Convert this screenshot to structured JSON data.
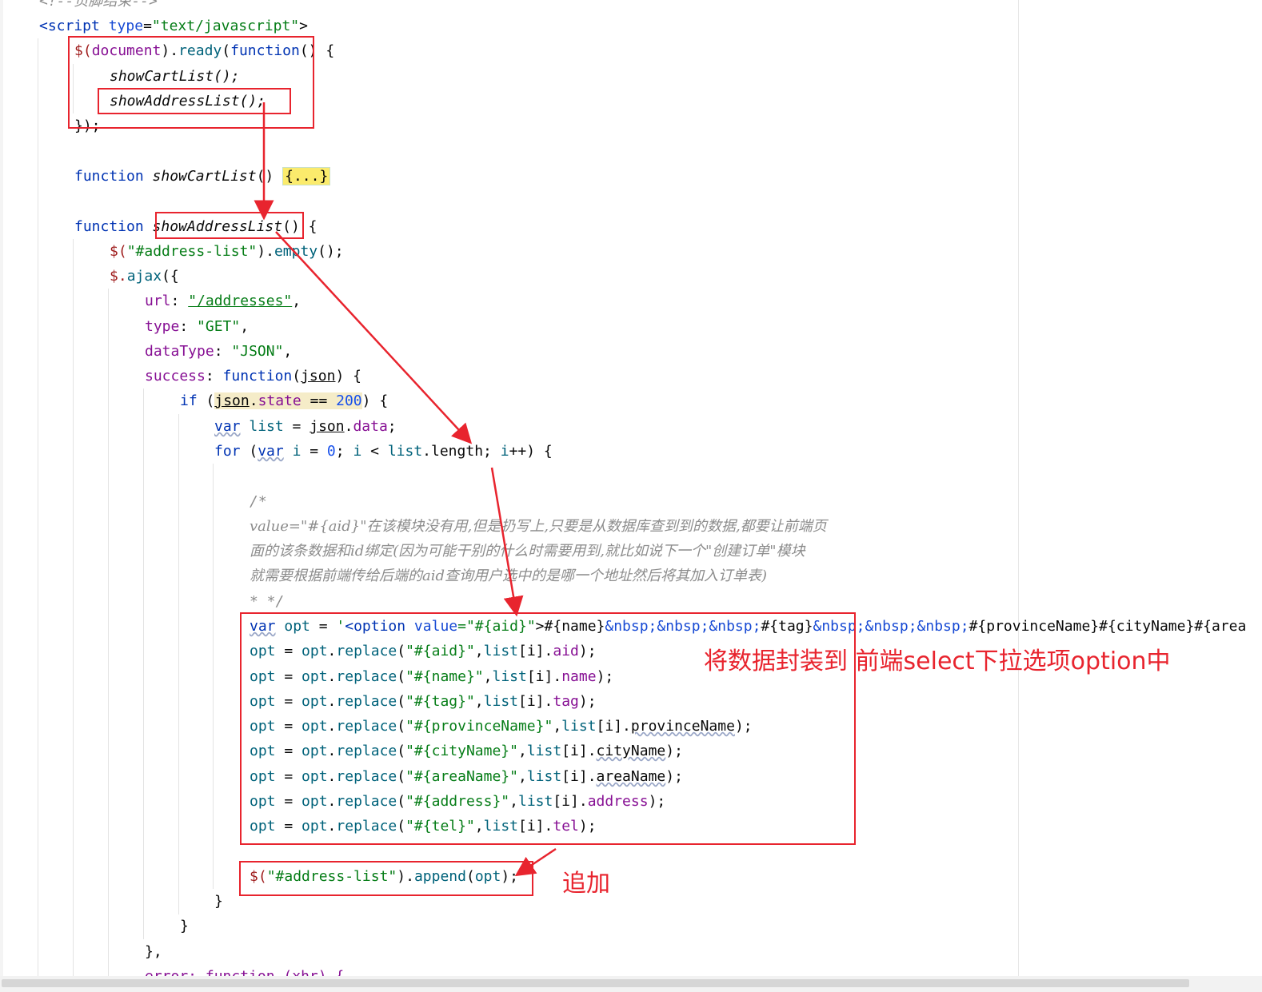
{
  "code": {
    "l0": "<!--页脚结束-->",
    "l1_tag": "<script",
    "l1_attr": "type",
    "l1_val": "\"text/javascript\"",
    "l1_end": ">",
    "l2_a": "$(",
    "l2_doc": "document",
    "l2_b": ").",
    "l2_ready": "ready",
    "l2_c": "(",
    "l2_fn": "function",
    "l2_d": "() {",
    "l3": "showCartList();",
    "l4": "showAddressList();",
    "l5": "});",
    "l6_fn": "function",
    "l6_name": "showCartList",
    "l6_paren": "()",
    "l6_fold": "{...}",
    "l7_fn": "function",
    "l7_name": "showAddressList",
    "l7_rest": "() {",
    "l8_a": "$(",
    "l8_str": "\"#address-list\"",
    "l8_b": ").",
    "l8_m": "empty",
    "l8_c": "();",
    "l9_a": "$.",
    "l9_m": "ajax",
    "l9_b": "({",
    "l10_k": "url",
    "l10_c": ": ",
    "l10_v": "\"/addresses\"",
    "l10_e": ",",
    "l11_k": "type",
    "l11_c": ": ",
    "l11_v": "\"GET\"",
    "l11_e": ",",
    "l12_k": "dataType",
    "l12_c": ": ",
    "l12_v": "\"JSON\"",
    "l12_e": ",",
    "l13_k": "success",
    "l13_c": ": ",
    "l13_fn": "function",
    "l13_p": "(",
    "l13_arg": "json",
    "l13_e": ") {",
    "l14_if": "if",
    "l14_a": " (",
    "l14_json": "json",
    "l14_dot": ".",
    "l14_state": "state",
    "l14_eq": " == ",
    "l14_num": "200",
    "l14_e": ") {",
    "l15_var": "var",
    "l15_list": "list",
    "l15_eq": " = ",
    "l15_json": "json",
    "l15_dot": ".",
    "l15_data": "data",
    "l15_e": ";",
    "l16_for": "for",
    "l16_a": " (",
    "l16_var": "var",
    "l16_i": "i",
    "l16_eq": " = ",
    "l16_num": "0",
    "l16_b": "; ",
    "l16_i2": "i",
    "l16_lt": " < ",
    "l16_list": "list",
    "l16_len": ".length",
    "l16_c": "; ",
    "l16_i3": "i",
    "l16_e": "++) {",
    "c1": "/*",
    "c2": "value=\"#{aid}\"在该模块没有用,但是扔写上,只要是从数据库查到到的数据,都要让前端页",
    "c3": "面的该条数据和id绑定(因为可能干别的什么时需要用到,就比如说下一个\"创建订单\"模块",
    "c4": "就需要根据前端传给后端的aid查询用户选中的是哪一个地址然后将其加入订单表)",
    "c5": "* */",
    "o0_var": "var",
    "o0_opt": "opt",
    "o0_eq": " = ",
    "o0_q": "'",
    "o0_tag": "<option",
    "o0_attr": " value",
    "o0_val": "=\"#{aid}\"",
    "o0_gt": ">",
    "o0_t1": "#{name}",
    "o0_nb1": "&nbsp;&nbsp;&nbsp;",
    "o0_t2": "#{tag}",
    "o0_nb2": "&nbsp;&nbsp;&nbsp;",
    "o0_t3": "#{provinceName}#{cityName}#{area",
    "r1_s": "\"#{aid}\"",
    "r1_p": "aid",
    "r2_s": "\"#{name}\"",
    "r2_p": "name",
    "r3_s": "\"#{tag}\"",
    "r3_p": "tag",
    "r4_s": "\"#{provinceName}\"",
    "r4_p": "provinceName",
    "r5_s": "\"#{cityName}\"",
    "r5_p": "cityName",
    "r6_s": "\"#{areaName}\"",
    "r6_p": "areaName",
    "r7_s": "\"#{address}\"",
    "r7_p": "address",
    "r8_s": "\"#{tel}\"",
    "r8_p": "tel",
    "opt": "opt",
    "eq": " = ",
    "dot": ".",
    "replace": "replace",
    "paren_open": "(",
    "comma": ",",
    "list": "list",
    "bracket_i": "[i]",
    "close": ");",
    "ap_a": "$(",
    "ap_str": "\"#address-list\"",
    "ap_b": ").",
    "ap_m": "append",
    "ap_c": "(",
    "ap_opt": "opt",
    "ap_e": ");",
    "b1": "}",
    "b2": "}",
    "b3": "},",
    "last": "error: function (xhr) {"
  },
  "annotations": {
    "encapsulate": "将数据封装到 前端select下拉选项option中",
    "append": "追加"
  },
  "colors": {
    "annotation_red": "#e8242e",
    "keyword": "#0033b3",
    "string": "#067d17",
    "comment": "#8c8c8c"
  }
}
